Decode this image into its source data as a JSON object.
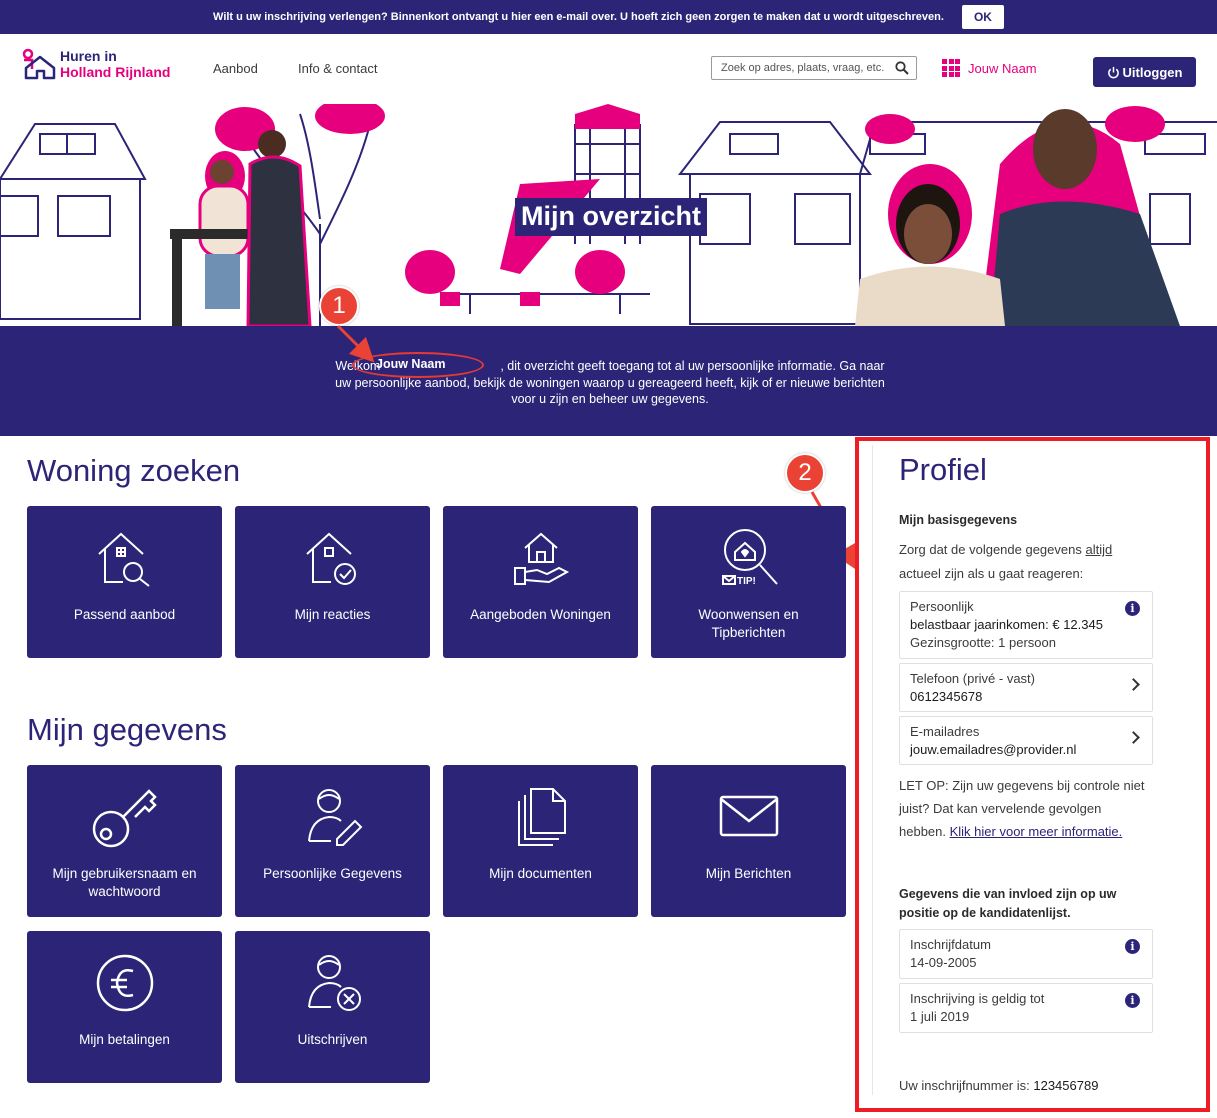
{
  "notice": {
    "text": "Wilt u uw inschrijving verlengen? Binnenkort ontvangt u hier een e-mail over. U hoeft zich geen zorgen te maken dat u wordt uitgeschreven.",
    "ok_label": "OK"
  },
  "header": {
    "logo_line1": "Huren in",
    "logo_line2": "Holland Rijnland",
    "nav": [
      "Aanbod",
      "Info & contact"
    ],
    "search_placeholder": "Zoek op adres, plaats, vraag, etc.",
    "user_name": "Jouw Naam",
    "logout_label": "Uitloggen"
  },
  "hero": {
    "title": "Mijn overzicht"
  },
  "welcome": {
    "prefix": "Welkom",
    "name": "Jouw Naam",
    "line1_rest": ", dit overzicht geeft toegang tot al uw persoonlijke informatie. Ga naar",
    "line2": "uw persoonlijke aanbod, bekijk de woningen waarop u gereageerd heeft, kijk of er nieuwe berichten",
    "line3": "voor u zijn en beheer uw gegevens."
  },
  "markers": [
    "1",
    "2"
  ],
  "woning_zoeken": {
    "title": "Woning zoeken",
    "tiles": [
      {
        "label": "Passend aanbod",
        "icon": "house-search-icon"
      },
      {
        "label": "Mijn reacties",
        "icon": "house-check-icon"
      },
      {
        "label": "Aangeboden Woningen",
        "icon": "house-hand-icon"
      },
      {
        "label": "Woonwensen en Tipberichten",
        "icon": "search-tip-icon",
        "tip": "TIP!"
      }
    ]
  },
  "mijn_gegevens": {
    "title": "Mijn gegevens",
    "tiles": [
      {
        "label": "Mijn gebruikersnaam en wachtwoord",
        "icon": "key-icon"
      },
      {
        "label": "Persoonlijke Gegevens",
        "icon": "user-edit-icon"
      },
      {
        "label": "Mijn documenten",
        "icon": "documents-icon"
      },
      {
        "label": "Mijn Berichten",
        "icon": "envelope-icon"
      },
      {
        "label": "Mijn betalingen",
        "icon": "euro-icon"
      },
      {
        "label": "Uitschrijven",
        "icon": "user-remove-icon"
      }
    ]
  },
  "profile": {
    "title": "Profiel",
    "basis_heading": "Mijn basisgegevens",
    "intro_part1": "Zorg dat de volgende gegevens ",
    "intro_link": "altijd",
    "intro_part2": "actueel zijn als u gaat reageren:",
    "persoonlijk": {
      "label": "Persoonlijk",
      "income": "belastbaar jaarinkomen: € 12.345",
      "household": "Gezinsgrootte: 1 persoon"
    },
    "phone": {
      "label": "Telefoon (privé - vast)",
      "value": "0612345678"
    },
    "email": {
      "label": "E-mailadres",
      "value": "jouw.emailadres@provider.nl"
    },
    "warning_line1": "LET OP: Zijn uw gegevens bij controle niet",
    "warning_line2": "juist? Dat kan vervelende gevolgen",
    "warning_line3": "hebben. ",
    "warning_link": "Klik hier voor meer informatie.",
    "position_heading_line1": "Gegevens die van invloed zijn op uw",
    "position_heading_line2": "positie op de kandidatenlijst.",
    "inschrijfdatum": {
      "label": "Inschrijfdatum",
      "value": "14-09-2005"
    },
    "geldig": {
      "label": "Inschrijving is geldig tot",
      "value": "1 juli 2019"
    },
    "nummer_label": "Uw inschrijfnummer is: ",
    "nummer_value": "123456789"
  }
}
